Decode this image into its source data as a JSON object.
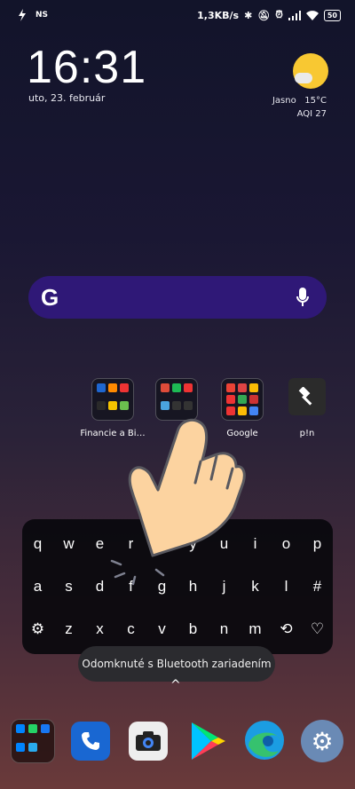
{
  "status_bar": {
    "left_indicator": "NS",
    "speed": "1,3KB/s",
    "battery": "50"
  },
  "clock": {
    "time": "16:31",
    "date": "uto, 23. február"
  },
  "weather": {
    "condition": "Jasno",
    "temperature": "15°C",
    "aqi": "AQI 27"
  },
  "search": {
    "logo": "G",
    "mic_icon": "mic-icon"
  },
  "home_apps": [
    {
      "label": "Financie a Bi…"
    },
    {
      "label": ""
    },
    {
      "label": "Google"
    },
    {
      "label": "p!n"
    }
  ],
  "keyboard": {
    "row1": [
      "q",
      "w",
      "e",
      "r",
      "t",
      "y",
      "u",
      "i",
      "o",
      "p"
    ],
    "row2": [
      "a",
      "s",
      "d",
      "f",
      "g",
      "h",
      "j",
      "k",
      "l",
      "#"
    ],
    "row3": [
      "z",
      "x",
      "c",
      "v",
      "b",
      "n",
      "m"
    ]
  },
  "toast": {
    "text": "Odomknuté s Bluetooth zariadením"
  },
  "chevron": "^",
  "colors": {
    "search_bg": "#2f1877",
    "keyboard_bg": "#08080c",
    "toast_bg": "#2b2b2f",
    "hand_fill": "#fcd3a0"
  }
}
